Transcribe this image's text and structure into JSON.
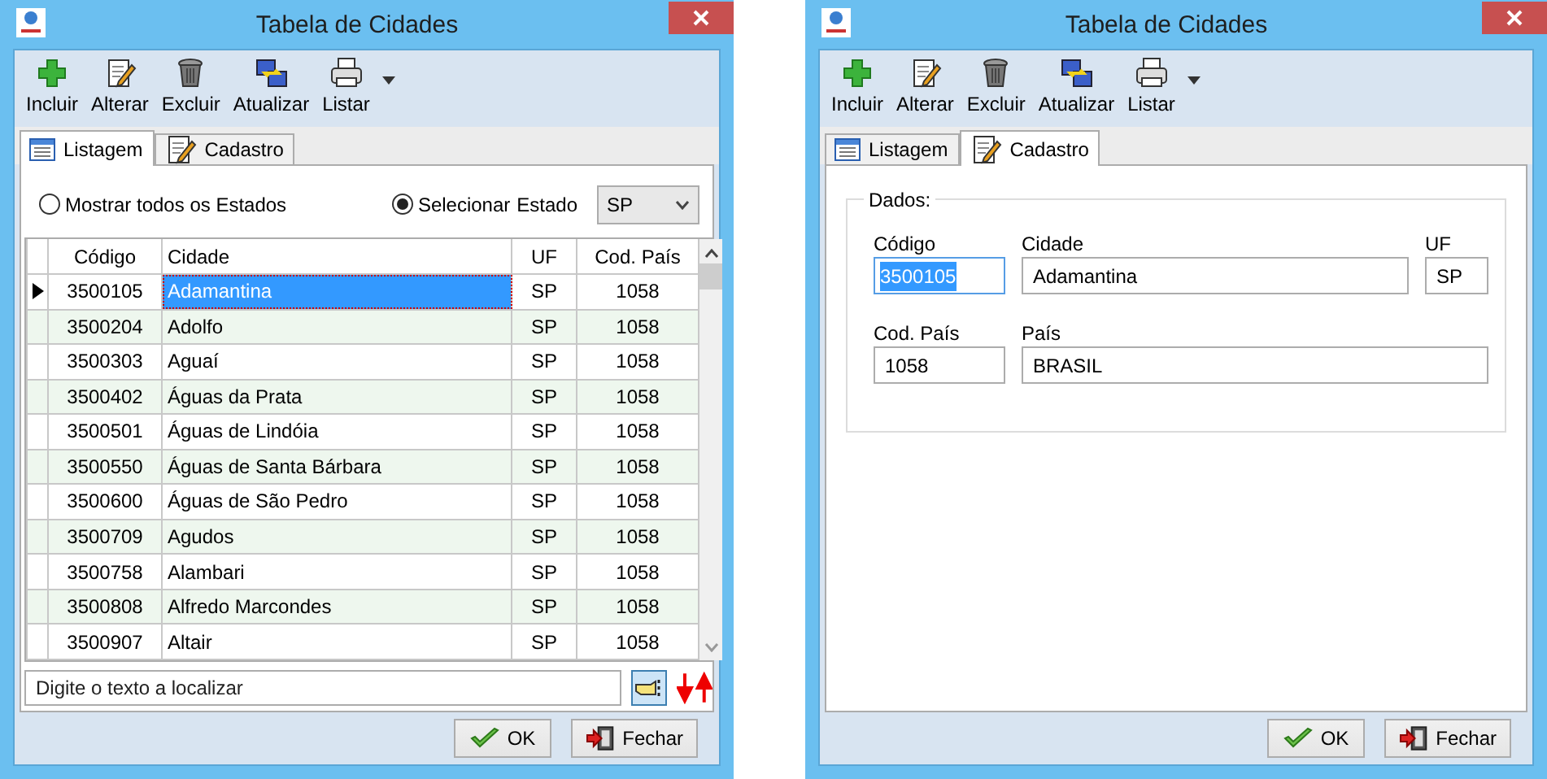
{
  "windows": [
    {
      "title": "Tabela de Cidades",
      "toolbar": [
        {
          "label": "Incluir",
          "kind": "add"
        },
        {
          "label": "Alterar",
          "kind": "edit"
        },
        {
          "label": "Excluir",
          "kind": "trash"
        },
        {
          "label": "Atualizar",
          "kind": "refresh"
        },
        {
          "label": "Listar",
          "kind": "print"
        }
      ],
      "tabs": [
        {
          "label": "Listagem",
          "kind": "list",
          "selected": true
        },
        {
          "label": "Cadastro",
          "kind": "edit",
          "selected": false
        }
      ],
      "content": {
        "kind": "listing",
        "filter": [
          {
            "label": "Mostrar todos os Estados",
            "selected": false
          },
          {
            "label": "Selecionar",
            "selected": true
          }
        ],
        "state_label": "Estado",
        "state_select": {
          "value": "SP"
        },
        "table": {
          "columns": [
            "Código",
            "Cidade",
            "UF",
            "Cod. País"
          ],
          "rows": [
            {
              "cells": [
                "3500105",
                "Adamantina",
                "SP",
                "1058"
              ],
              "selected": true
            },
            {
              "cells": [
                "3500204",
                "Adolfo",
                "SP",
                "1058"
              ],
              "selected": false
            },
            {
              "cells": [
                "3500303",
                "Aguaí",
                "SP",
                "1058"
              ],
              "selected": false
            },
            {
              "cells": [
                "3500402",
                "Águas da Prata",
                "SP",
                "1058"
              ],
              "selected": false
            },
            {
              "cells": [
                "3500501",
                "Águas de Lindóia",
                "SP",
                "1058"
              ],
              "selected": false
            },
            {
              "cells": [
                "3500550",
                "Águas de Santa Bárbara",
                "SP",
                "1058"
              ],
              "selected": false
            },
            {
              "cells": [
                "3500600",
                "Águas de São Pedro",
                "SP",
                "1058"
              ],
              "selected": false
            },
            {
              "cells": [
                "3500709",
                "Agudos",
                "SP",
                "1058"
              ],
              "selected": false
            },
            {
              "cells": [
                "3500758",
                "Alambari",
                "SP",
                "1058"
              ],
              "selected": false
            },
            {
              "cells": [
                "3500808",
                "Alfredo Marcondes",
                "SP",
                "1058"
              ],
              "selected": false
            },
            {
              "cells": [
                "3500907",
                "Altair",
                "SP",
                "1058"
              ],
              "selected": false
            }
          ]
        },
        "search": {
          "placeholder": "Digite o texto a localizar"
        }
      },
      "buttons": [
        {
          "label": "OK",
          "kind": "ok"
        },
        {
          "label": "Fechar",
          "kind": "exit"
        }
      ]
    },
    {
      "title": "Tabela de Cidades",
      "toolbar": [
        {
          "label": "Incluir",
          "kind": "add"
        },
        {
          "label": "Alterar",
          "kind": "edit"
        },
        {
          "label": "Excluir",
          "kind": "trash"
        },
        {
          "label": "Atualizar",
          "kind": "refresh"
        },
        {
          "label": "Listar",
          "kind": "print"
        }
      ],
      "tabs": [
        {
          "label": "Listagem",
          "kind": "list",
          "selected": false
        },
        {
          "label": "Cadastro",
          "kind": "edit",
          "selected": true
        }
      ],
      "content": {
        "kind": "form",
        "group": "Dados:",
        "fields": [
          {
            "label": "Código",
            "value": "3500105",
            "focused": true
          },
          {
            "label": "Cidade",
            "value": "Adamantina",
            "focused": false
          },
          {
            "label": "UF",
            "value": "SP",
            "focused": false
          },
          {
            "label": "Cod. País",
            "value": "1058",
            "focused": false
          },
          {
            "label": "País",
            "value": "BRASIL",
            "focused": false
          }
        ]
      },
      "buttons": [
        {
          "label": "OK",
          "kind": "ok"
        },
        {
          "label": "Fechar",
          "kind": "exit"
        }
      ]
    }
  ]
}
